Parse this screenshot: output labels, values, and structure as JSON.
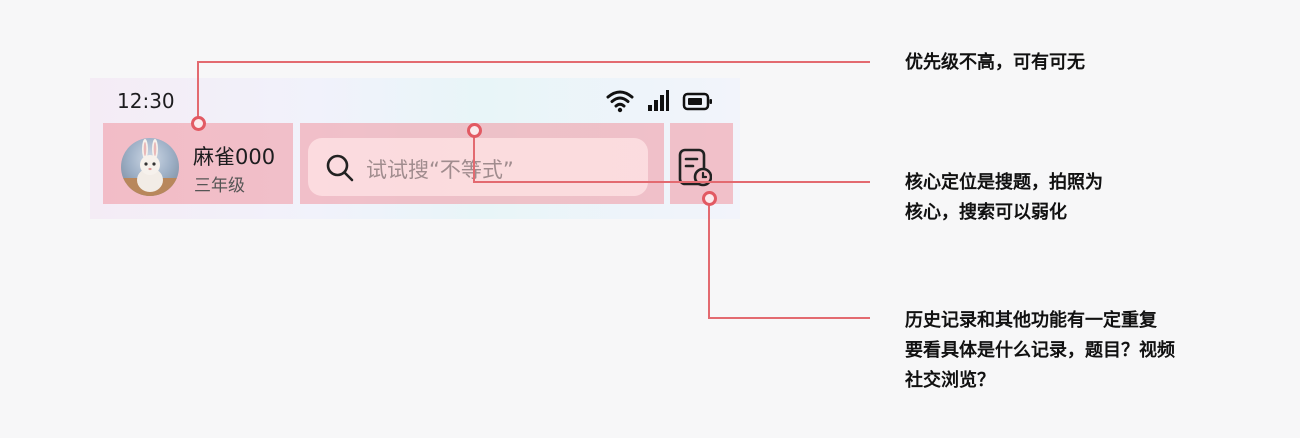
{
  "status_bar": {
    "time": "12:30",
    "icons": [
      "wifi-icon",
      "signal-icon",
      "battery-icon"
    ]
  },
  "user": {
    "name": "麻雀000",
    "grade": "三年级",
    "avatar": "rabbit-avatar"
  },
  "search": {
    "placeholder": "试试搜“不等式”",
    "icon": "search-icon"
  },
  "history": {
    "icon": "history-record-icon"
  },
  "annotations": [
    {
      "text": "优先级不高，可有可无"
    },
    {
      "text": "核心定位是搜题，拍照为\n核心，搜索可以弱化"
    },
    {
      "text": "历史记录和其他功能有一定重复\n要看具体是什么记录，题目？视频\n社交浏览？"
    }
  ],
  "colors": {
    "annotation_line": "#e36a70",
    "highlight": "#f096a0"
  }
}
